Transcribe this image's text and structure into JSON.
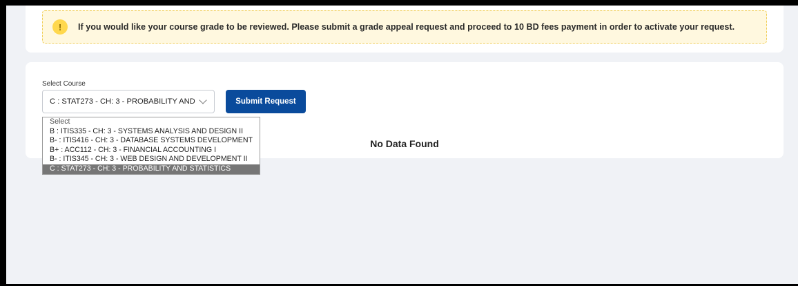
{
  "alert": {
    "icon": "warning-exclamation-icon",
    "icon_glyph": "!",
    "message": "If you would like your course grade to be reviewed. Please submit a grade appeal request and proceed to 10 BD fees payment in order to activate your request."
  },
  "course_form": {
    "label": "Select Course",
    "selected_value": "C : STAT273 - CH: 3 - PROBABILITY AND STATISTICS",
    "submit_label": "Submit Request",
    "options": [
      "Select",
      "B : ITIS335 - CH: 3 - SYSTEMS ANALYSIS AND DESIGN II",
      "B- : ITIS416 - CH: 3 - DATABASE SYSTEMS DEVELOPMENT",
      "B+ : ACC112 - CH: 3 - FINANCIAL ACCOUNTING I",
      "B- : ITIS345 - CH: 3 - WEB DESIGN AND DEVELOPMENT II",
      "C : STAT273 - CH: 3 - PROBABILITY AND STATISTICS"
    ]
  },
  "results": {
    "empty_message": "No Data Found"
  },
  "colors": {
    "primary_button": "#0a4b9c",
    "alert_background": "#fff8df",
    "alert_border": "#f0cd54",
    "selected_option": "#767676"
  }
}
